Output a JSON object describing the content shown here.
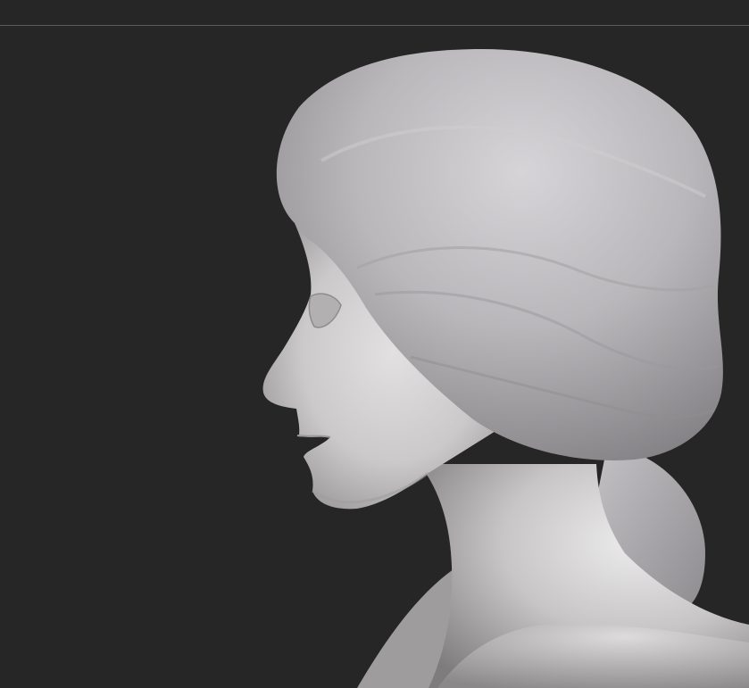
{
  "viewport": {
    "background": "#262626",
    "divider_color": "#5a5a5a"
  },
  "model": {
    "subject": "female-head-bust",
    "view": "left-profile",
    "material_color": "#c8c6c7",
    "hair_color": "#bdbbbd"
  }
}
